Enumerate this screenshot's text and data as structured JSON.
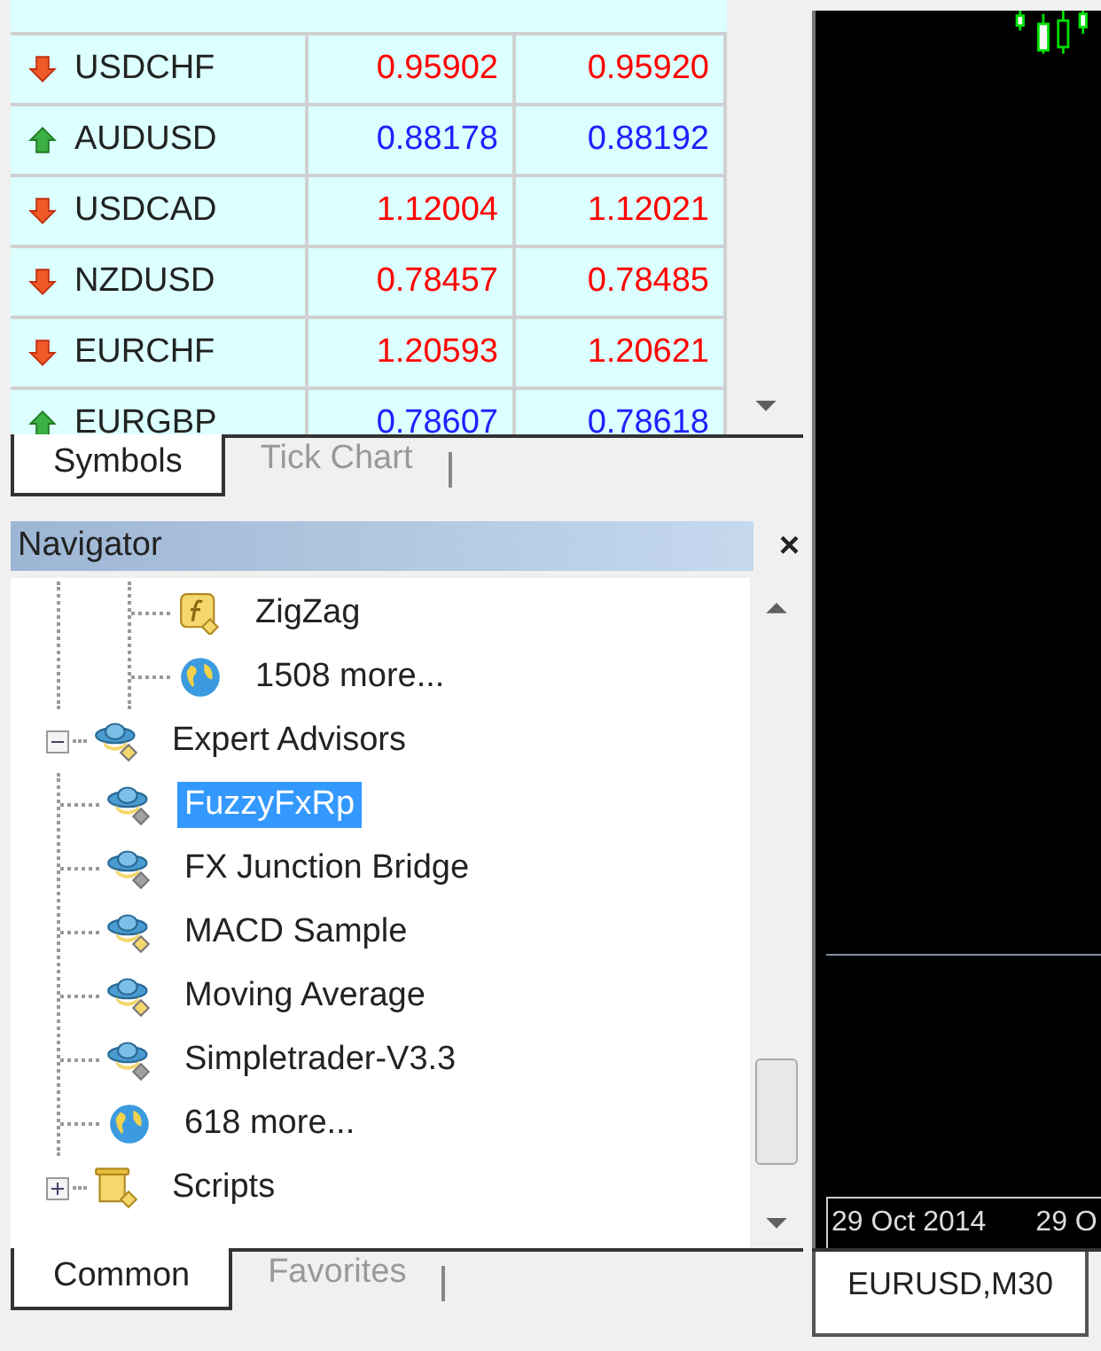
{
  "market_watch": {
    "rows": [
      {
        "symbol": "USDCHF",
        "kind": "down",
        "bid": "0.95902",
        "ask": "0.95920"
      },
      {
        "symbol": "AUDUSD",
        "kind": "up",
        "bid": "0.88178",
        "ask": "0.88192"
      },
      {
        "symbol": "USDCAD",
        "kind": "down",
        "bid": "1.12004",
        "ask": "1.12021"
      },
      {
        "symbol": "NZDUSD",
        "kind": "down",
        "bid": "0.78457",
        "ask": "0.78485"
      },
      {
        "symbol": "EURCHF",
        "kind": "down",
        "bid": "1.20593",
        "ask": "1.20621"
      },
      {
        "symbol": "EURGBP",
        "kind": "up",
        "bid": "0.78607",
        "ask": "0.78618"
      }
    ],
    "tabs": [
      {
        "label": "Symbols",
        "selected": true
      },
      {
        "label": "Tick Chart",
        "selected": false
      }
    ]
  },
  "navigator": {
    "title": "Navigator",
    "close": "×",
    "upper_children": [
      {
        "label": "ZigZag",
        "kind": "indicator",
        "selected": false
      },
      {
        "label": "1508 more...",
        "kind": "more",
        "selected": false
      }
    ],
    "items": [
      {
        "label": "Expert Advisors",
        "kind": "expert",
        "expanded": true,
        "selected": false,
        "children": [
          {
            "label": "FuzzyFxRp",
            "kind": "expert-dim",
            "selected": true
          },
          {
            "label": "FX Junction Bridge",
            "kind": "expert-dim",
            "selected": false
          },
          {
            "label": "MACD Sample",
            "kind": "expert",
            "selected": false
          },
          {
            "label": "Moving Average",
            "kind": "expert",
            "selected": false
          },
          {
            "label": "Simpletrader-V3.3",
            "kind": "expert-dim",
            "selected": false
          },
          {
            "label": "618 more...",
            "kind": "more",
            "selected": false
          }
        ]
      },
      {
        "label": "Scripts",
        "kind": "script",
        "expanded": false,
        "selected": false
      }
    ],
    "tabs": [
      {
        "label": "Common",
        "selected": true
      },
      {
        "label": "Favorites",
        "selected": false
      }
    ]
  },
  "chart": {
    "time_labels": [
      "29 Oct 2014",
      "29 O"
    ],
    "tabs": [
      {
        "label": "EURUSD,M30",
        "selected": true
      }
    ]
  }
}
